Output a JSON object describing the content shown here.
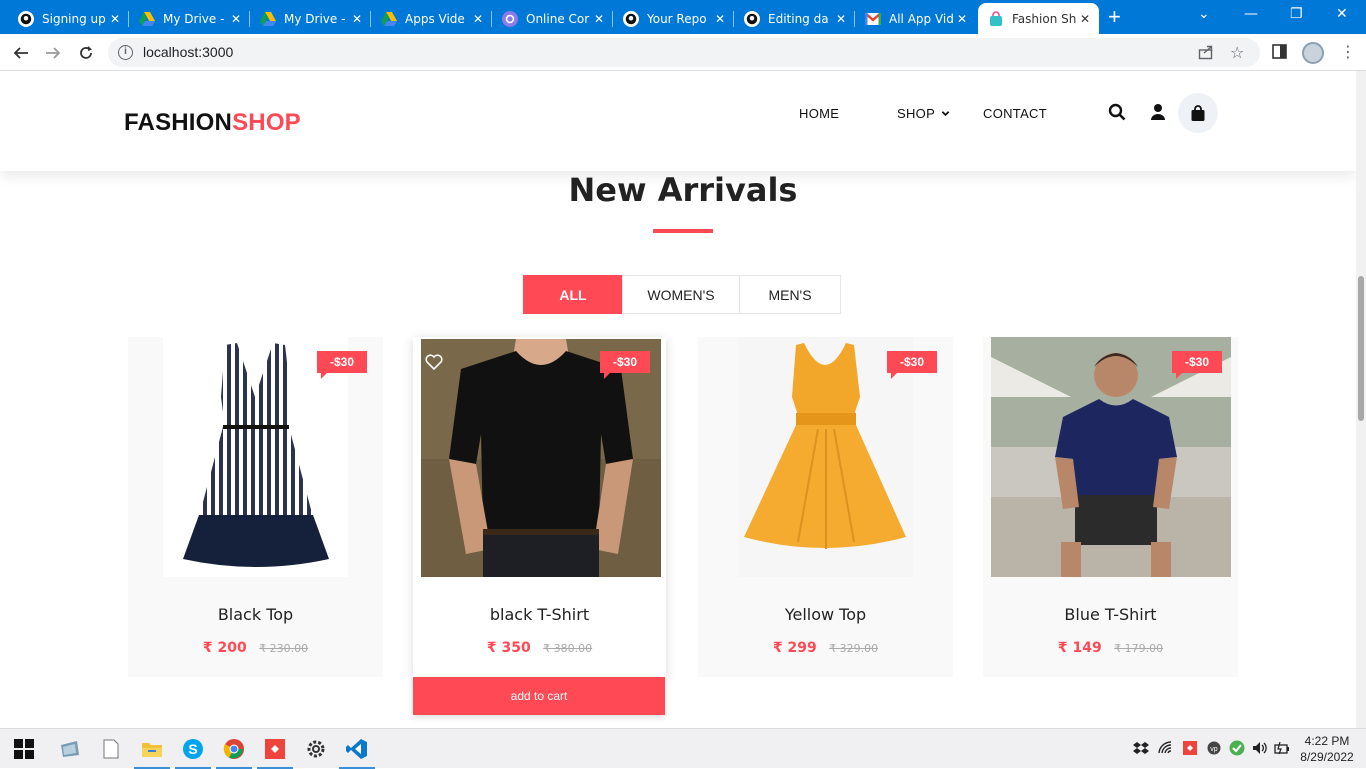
{
  "browser": {
    "tabs": [
      {
        "title": "Signing up",
        "icon": "github-icon",
        "active": false
      },
      {
        "title": "My Drive -",
        "icon": "google-drive-icon",
        "active": false
      },
      {
        "title": "My Drive -",
        "icon": "google-drive-icon",
        "active": false
      },
      {
        "title": "Apps Vide",
        "icon": "google-drive-icon",
        "active": false
      },
      {
        "title": "Online Cor",
        "icon": "converter-icon",
        "active": false
      },
      {
        "title": "Your Repo",
        "icon": "github-icon",
        "active": false
      },
      {
        "title": "Editing da",
        "icon": "github-icon",
        "active": false
      },
      {
        "title": "All App Vid",
        "icon": "gmail-icon",
        "active": false
      },
      {
        "title": "Fashion Sh",
        "icon": "shopping-bag-icon",
        "active": true
      }
    ],
    "url": "localhost:3000"
  },
  "site": {
    "logo_part1": "FASHION",
    "logo_part2": "SHOP",
    "menu": {
      "home": "HOME",
      "shop": "SHOP",
      "contact": "CONTACT"
    }
  },
  "section": {
    "title": "New Arrivals",
    "filters": [
      "ALL",
      "WOMEN'S",
      "MEN'S"
    ],
    "active_filter": "ALL"
  },
  "products": [
    {
      "name": "Black Top",
      "price": "₹ 200",
      "old_price": "₹ 230.00",
      "badge": "-$30",
      "image": "striped-dress"
    },
    {
      "name": "black T-Shirt",
      "price": "₹ 350",
      "old_price": "₹ 380.00",
      "badge": "-$30",
      "image": "black-tshirt-man"
    },
    {
      "name": "Yellow Top",
      "price": "₹ 299",
      "old_price": "₹ 329.00",
      "badge": "-$30",
      "image": "yellow-dress"
    },
    {
      "name": "Blue T-Shirt",
      "price": "₹ 149",
      "old_price": "₹ 179.00",
      "badge": "-$30",
      "image": "blue-tshirt-man"
    }
  ],
  "hovered_product": {
    "add_to_cart": "add to cart"
  },
  "taskbar": {
    "time": "4:22 PM",
    "date": "8/29/2022"
  },
  "colors": {
    "accent": "#ff4a55",
    "tab_bar": "#0078d7"
  }
}
